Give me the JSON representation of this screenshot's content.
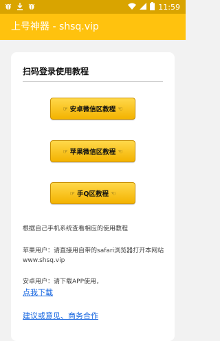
{
  "status_bar": {
    "time": "11:59",
    "left_icons": [
      "bug-icon",
      "download-icon",
      "bug-icon"
    ],
    "right_icons": [
      "wifi-icon",
      "signal-icon",
      "battery-icon"
    ]
  },
  "app_bar": {
    "title": "上号神器 - shsq.vip"
  },
  "card": {
    "title": "扫码登录使用教程",
    "buttons": [
      {
        "label": "安卓微信区教程",
        "hand_left": "☞",
        "hand_right": "☜"
      },
      {
        "label": "苹果微信区教程",
        "hand_left": "☞",
        "hand_right": "☜"
      },
      {
        "label": "手Q区教程",
        "hand_left": "☞",
        "hand_right": "☜"
      }
    ],
    "intro": "根据自己手机系统查看相应的使用教程",
    "apple_note": "苹果用户：请直接用自带的safari浏览器打开本网站www.shsq.vip",
    "android_note": "安卓用户：请下载APP使用，",
    "download_link": "点我下载",
    "feedback_link": "建议或意见、商务合作"
  },
  "colors": {
    "status_bar": "#d9a400",
    "app_bar": "#ffc20e",
    "button": "#f7c21b",
    "link": "#1565e0",
    "background": "#f2f2f2"
  }
}
